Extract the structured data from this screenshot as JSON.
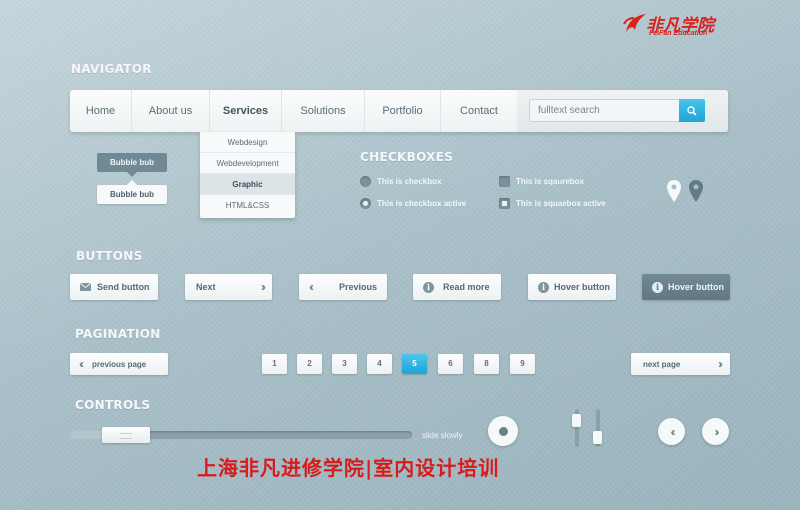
{
  "logo": {
    "cn": "非凡学院",
    "en": "FeiFan Education",
    "color": "#d8231f"
  },
  "sections": {
    "navigator": "NAVIGATOR",
    "checkboxes": "CHECKBOXES",
    "buttons": "BUTTONS",
    "pagination": "PAGINATION",
    "controls": "CONTROLS"
  },
  "nav": {
    "items": [
      "Home",
      "About us",
      "Services",
      "Solutions",
      "Portfolio",
      "Contact"
    ],
    "active": "Services",
    "search_value": "fulltext search",
    "search_icon": "search-icon"
  },
  "dropdown": {
    "items": [
      "Webdesign",
      "Webdevelopment",
      "Graphic",
      "HTML&CSS"
    ],
    "active": "Graphic"
  },
  "bubbles": {
    "dark": "Bubble bub",
    "light": "Bubble bub"
  },
  "checkboxes": {
    "radio_off": "This is checkbox",
    "radio_on": "This is checkbox active",
    "square_off": "This is sqaurebox",
    "square_on": "This is squaebox active"
  },
  "buttons": {
    "send": "Send button",
    "next": "Next",
    "previous": "Previous",
    "read_more": "Read more",
    "hover": "Hover button",
    "hover_active": "Hover button"
  },
  "pagination": {
    "prev": "previous page",
    "next": "next page",
    "pages": [
      "1",
      "2",
      "3",
      "4",
      "5",
      "6",
      "8",
      "9"
    ],
    "current": "5",
    "accent": "#1da3d5"
  },
  "controls": {
    "slider_label": "slide slowly",
    "slider_value": 0.17
  },
  "banner": "上海非凡进修学院|室内设计培训",
  "banner_color": "#d71b1b"
}
